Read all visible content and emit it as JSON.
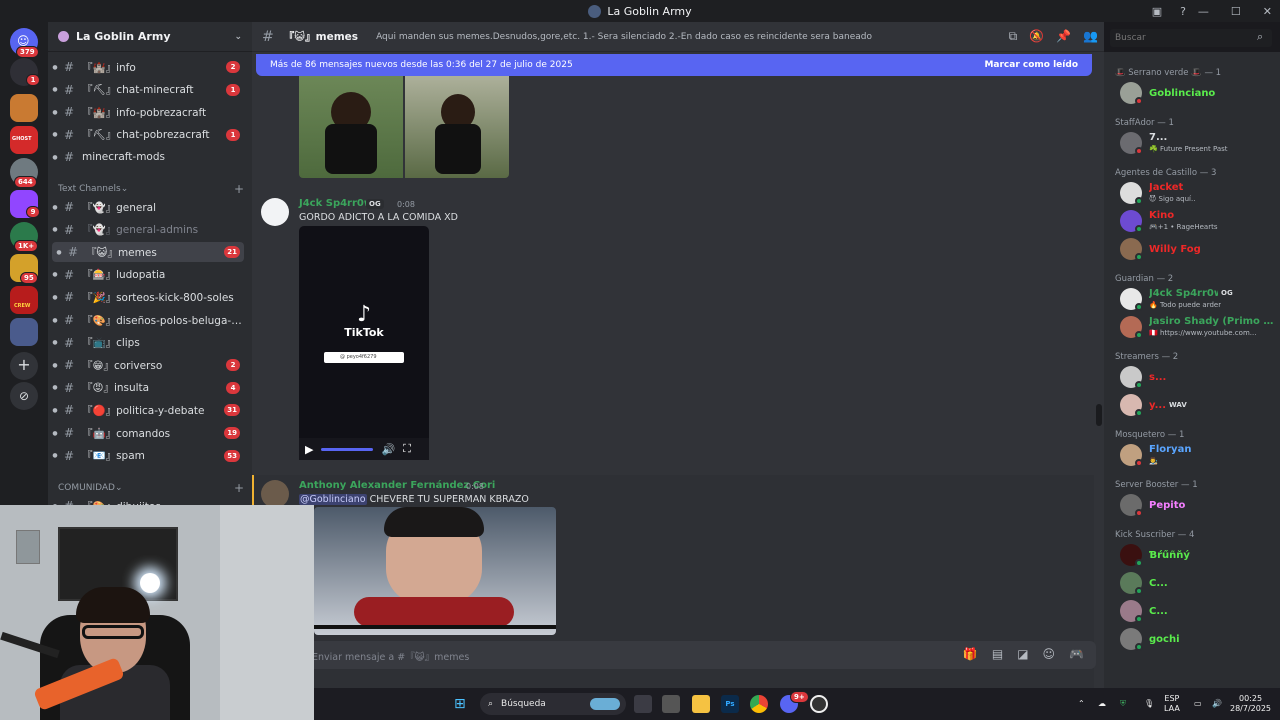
{
  "window": {
    "title": "La Goblin Army"
  },
  "rail": {
    "home_badge": "379",
    "badges": [
      "1",
      "644",
      "9",
      "1K+",
      "95"
    ],
    "serverLabels": {
      "ghost": "GHOST",
      "crew": "CREW"
    }
  },
  "server": {
    "name": "La Goblin Army"
  },
  "sidebar": {
    "channels_top": [
      {
        "name": "『🏰』info",
        "badge": "2"
      },
      {
        "name": "『⛏』chat-minecraft",
        "badge": "1"
      },
      {
        "name": "『🏰』info-pobrezacraft",
        "badge": ""
      },
      {
        "name": "『⛏』chat-pobrezacraft",
        "badge": "1"
      },
      {
        "name": "minecraft-mods",
        "badge": ""
      }
    ],
    "cat_text": "Text Channels",
    "channels_text": [
      {
        "name": "『👻』general",
        "badge": ""
      },
      {
        "name": "『👻』general-admins",
        "badge": ""
      },
      {
        "name": "『😺』memes",
        "badge": "21"
      },
      {
        "name": "『🎰』ludopatia",
        "badge": ""
      },
      {
        "name": "『🎉』sorteos-kick-800-soles",
        "badge": ""
      },
      {
        "name": "『🎨』diseños-polos-beluga-ar...",
        "badge": ""
      },
      {
        "name": "『📺』clips",
        "badge": ""
      },
      {
        "name": "『😁』coriverso",
        "badge": "2"
      },
      {
        "name": "『😡』insulta",
        "badge": "4"
      },
      {
        "name": "『🔴』politica-y-debate",
        "badge": "31"
      },
      {
        "name": "『🤖』comandos",
        "badge": "19"
      },
      {
        "name": "『📧』spam",
        "badge": "53"
      }
    ],
    "cat_comunidad": "COMUNIDAD",
    "partial_channel": "『🎨』dibujitos"
  },
  "channel": {
    "name": "『😺』memes",
    "topic": "Aqui manden sus memes.Desnudos,gore,etc. 1.- Sera silenciado 2.-En dado caso es reincidente sera baneado"
  },
  "search": {
    "placeholder": "Buscar"
  },
  "newbar": {
    "text": "Más de 86 mensajes nuevos desde las 0:36 del 27 de julio de 2025",
    "mark": "Marcar como leído"
  },
  "messages": [
    {
      "author": "J4ck Sp4rr0w",
      "tag": "OG",
      "time": "0:08",
      "text": "GORDO ADICTO A LA COMIDA XD"
    },
    {
      "author": "Anthony Alexander Fernández Cori",
      "time": "0:08",
      "mention": "@Goblinciano",
      "text": "CHEVERE TU SUPERMAN KBRAZO"
    }
  ],
  "tiktok": {
    "brand": "TikTok",
    "user": "@ peyo4f6279"
  },
  "composer": {
    "placeholder": "Enviar mensaje a #『😺』memes"
  },
  "members": {
    "groups": [
      {
        "title": "🎩 Serrano verde 🎩 — 1",
        "items": [
          {
            "name": "Goblinciano",
            "status": "",
            "color": "#5aec4c"
          }
        ]
      },
      {
        "title": "StaffAdor — 1",
        "items": [
          {
            "name": "7...",
            "status": "☘️ Future Present Past",
            "color": "#dbdee1"
          }
        ]
      },
      {
        "title": "Agentes de Castillo — 3",
        "items": [
          {
            "name": "Jacket",
            "status": "😈 Sigo aquí..",
            "color": "#ed2828"
          },
          {
            "name": "Kino",
            "status": "🎮+1 • RageHearts",
            "color": "#ed2828"
          },
          {
            "name": "Willy Fog",
            "status": "",
            "color": "#ed2828"
          }
        ]
      },
      {
        "title": "Guardian — 2",
        "items": [
          {
            "name": "J4ck Sp4rr0w",
            "status": "🔥 Todo puede arder",
            "color": "#3ba55c"
          },
          {
            "name": "Jasiro Shady (Primo d...",
            "status": "🇵🇪 https://www.youtube.com...",
            "color": "#3ba55c"
          }
        ]
      },
      {
        "title": "Streamers — 2",
        "items": [
          {
            "name": "s...",
            "status": "",
            "color": "#ed2828"
          },
          {
            "name": "y...",
            "status": "",
            "color": "#ed2828"
          }
        ]
      },
      {
        "title": "Mosquetero — 1",
        "items": [
          {
            "name": "Floryan",
            "status": "👨‍🎨",
            "color": "#5aa5ff"
          }
        ]
      },
      {
        "title": "Server Booster — 1",
        "items": [
          {
            "name": "Pepito",
            "status": "",
            "color": "#f47fff"
          }
        ]
      },
      {
        "title": "Kick Suscriber — 4",
        "items": [
          {
            "name": "Ɓŕűñňý",
            "status": "",
            "color": "#5aec4c"
          },
          {
            "name": "C...",
            "status": "",
            "color": "#5aec4c"
          },
          {
            "name": "C...",
            "status": "",
            "color": "#5aec4c"
          },
          {
            "name": "gochi",
            "status": "",
            "color": "#5aec4c"
          }
        ]
      }
    ],
    "og_tag": "OG",
    "wav_tag": "WAV"
  },
  "taskbar": {
    "search": "Búsqueda",
    "lang": "ESP",
    "lang2": "LAA",
    "time": "00:25",
    "date": "28/7/2025",
    "discord_badge": "9+"
  }
}
